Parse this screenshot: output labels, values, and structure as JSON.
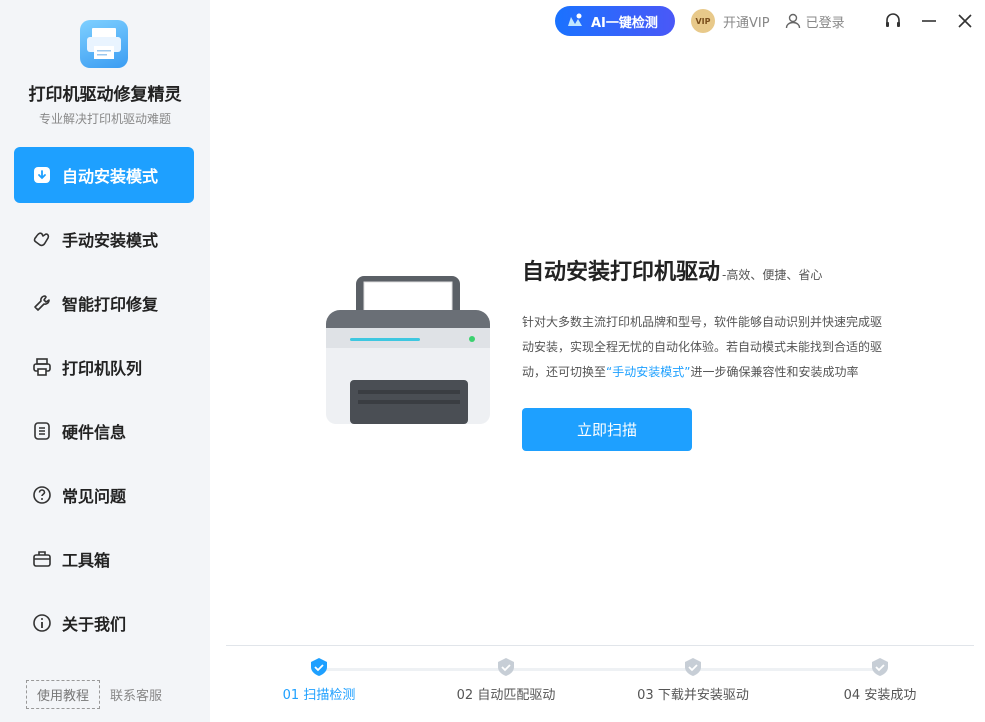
{
  "app": {
    "title": "打印机驱动修复精灵",
    "subtitle": "专业解决打印机驱动难题"
  },
  "topbar": {
    "ai_button": "AI一键检测",
    "vip_label": "开通VIP",
    "vip_badge": "VIP",
    "login_label": "已登录"
  },
  "sidebar": {
    "items": [
      {
        "label": "自动安装模式",
        "icon": "download-icon",
        "active": true
      },
      {
        "label": "手动安装模式",
        "icon": "hand-icon",
        "active": false
      },
      {
        "label": "智能打印修复",
        "icon": "wrench-icon",
        "active": false
      },
      {
        "label": "打印机队列",
        "icon": "printer-icon",
        "active": false
      },
      {
        "label": "硬件信息",
        "icon": "list-icon",
        "active": false
      },
      {
        "label": "常见问题",
        "icon": "question-icon",
        "active": false
      },
      {
        "label": "工具箱",
        "icon": "toolbox-icon",
        "active": false
      },
      {
        "label": "关于我们",
        "icon": "info-icon",
        "active": false
      }
    ],
    "footer": {
      "tutorial": "使用教程",
      "support": "联系客服"
    }
  },
  "main": {
    "title": "自动安装打印机驱动",
    "tagline": "-高效、便捷、省心",
    "desc_part1": "针对大多数主流打印机品牌和型号，软件能够自动识别并快速完成驱动安装，实现全程无忧的自动化体验。若自动模式未能找到合适的驱动，还可切换至",
    "desc_link": "“手动安装模式”",
    "desc_part2": "进一步确保兼容性和安装成功率",
    "scan_button": "立即扫描"
  },
  "steps": [
    {
      "label": "01 扫描检测",
      "active": true
    },
    {
      "label": "02 自动匹配驱动",
      "active": false
    },
    {
      "label": "03 下载并安装驱动",
      "active": false
    },
    {
      "label": "04 安装成功",
      "active": false
    }
  ],
  "colors": {
    "accent": "#1ea0ff",
    "sidebar_bg": "#f3f5f8",
    "ai_gradient_start": "#1a72ff",
    "ai_gradient_end": "#4a58f7",
    "inactive_step": "#c7ced6"
  }
}
